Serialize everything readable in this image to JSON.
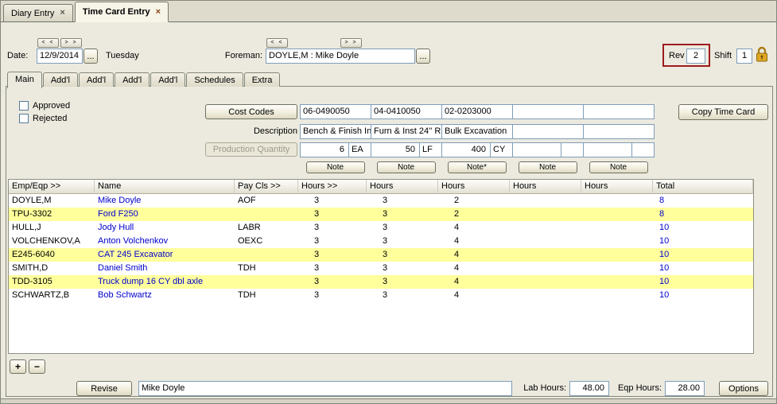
{
  "doc_tabs": {
    "diary": "Diary Entry",
    "timecard": "Time Card Entry"
  },
  "header": {
    "prev": "< <",
    "next": "> >",
    "date_label": "Date:",
    "date_value": "12/9/2014",
    "browse": "...",
    "day": "Tuesday",
    "foreman_label": "Foreman:",
    "foreman_value": "DOYLE,M : Mike Doyle",
    "rev_label": "Rev",
    "rev_value": "2",
    "shift_label": "Shift",
    "shift_value": "1"
  },
  "section_tabs": [
    "Main",
    "Add'l",
    "Add'l",
    "Add'l",
    "Add'l",
    "Schedules",
    "Extra"
  ],
  "main": {
    "approved": "Approved",
    "rejected": "Rejected",
    "cost_codes_button": "Cost Codes",
    "description_label": "Description",
    "production_label": "Production Quantity",
    "copy_button": "Copy Time Card",
    "cost_codes": [
      "06-0490050",
      "04-0410050",
      "02-0203000",
      "",
      ""
    ],
    "descriptions": [
      "Bench & Finish In",
      "Furn & Inst 24'' R",
      "Bulk Excavation",
      "",
      ""
    ],
    "quantities": [
      {
        "qty": "6",
        "uom": "EA"
      },
      {
        "qty": "50",
        "uom": "LF"
      },
      {
        "qty": "400",
        "uom": "CY"
      },
      {
        "qty": "",
        "uom": ""
      },
      {
        "qty": "",
        "uom": ""
      }
    ],
    "notes": [
      "Note",
      "Note",
      "Note*",
      "Note",
      "Note"
    ]
  },
  "table": {
    "headers": [
      "Emp/Eqp >>",
      "Name",
      "Pay Cls >>",
      "Hours >>",
      "Hours",
      "Hours",
      "Hours",
      "Hours",
      "Total"
    ],
    "rows": [
      {
        "code": "DOYLE,M",
        "name": "Mike Doyle",
        "pay": "AOF",
        "hours": [
          "3",
          "3",
          "2",
          "",
          ""
        ],
        "total": "8",
        "equipment": false
      },
      {
        "code": "TPU-3302",
        "name": "Ford F250",
        "pay": "",
        "hours": [
          "3",
          "3",
          "2",
          "",
          ""
        ],
        "total": "8",
        "equipment": true
      },
      {
        "code": "HULL,J",
        "name": "Jody Hull",
        "pay": "LABR",
        "hours": [
          "3",
          "3",
          "4",
          "",
          ""
        ],
        "total": "10",
        "equipment": false
      },
      {
        "code": "VOLCHENKOV,A",
        "name": "Anton Volchenkov",
        "pay": "OEXC",
        "hours": [
          "3",
          "3",
          "4",
          "",
          ""
        ],
        "total": "10",
        "equipment": false
      },
      {
        "code": "E245-6040",
        "name": "CAT 245 Excavator",
        "pay": "",
        "hours": [
          "3",
          "3",
          "4",
          "",
          ""
        ],
        "total": "10",
        "equipment": true
      },
      {
        "code": "SMITH,D",
        "name": "Daniel Smith",
        "pay": "TDH",
        "hours": [
          "3",
          "3",
          "4",
          "",
          ""
        ],
        "total": "10",
        "equipment": false
      },
      {
        "code": "TDD-3105",
        "name": "Truck dump 16 CY dbl axle",
        "pay": "",
        "hours": [
          "3",
          "3",
          "4",
          "",
          ""
        ],
        "total": "10",
        "equipment": true
      },
      {
        "code": "SCHWARTZ,B",
        "name": "Bob Schwartz",
        "pay": "TDH",
        "hours": [
          "3",
          "3",
          "4",
          "",
          ""
        ],
        "total": "10",
        "equipment": false
      }
    ]
  },
  "controls": {
    "add": "+",
    "remove": "−"
  },
  "footer": {
    "revise_button": "Revise",
    "foreman_name": "Mike Doyle",
    "lab_hours_label": "Lab Hours:",
    "lab_hours_value": "48.00",
    "eqp_hours_label": "Eqp Hours:",
    "eqp_hours_value": "28.00",
    "options_button": "Options"
  },
  "colors": {
    "equipment_row_yellow": "#ffff9c",
    "link_blue": "#0000cd",
    "rev_highlight_red": "#9e1b1e",
    "lock_gold": "#e0a823"
  }
}
